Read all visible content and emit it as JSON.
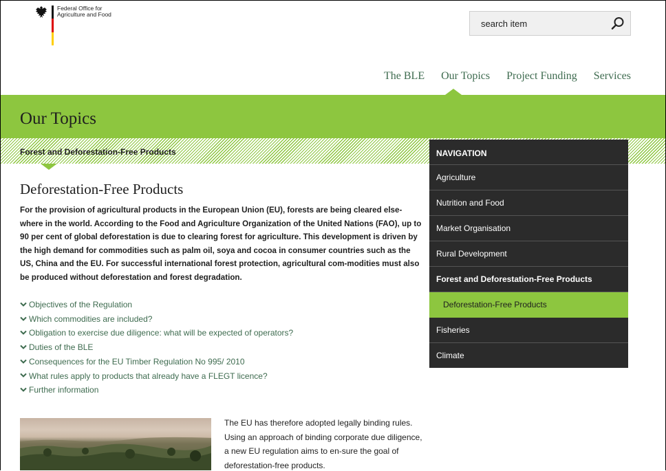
{
  "header": {
    "logo_line1": "Federal Office for",
    "logo_line2": "Agriculture and Food",
    "search_placeholder": "search item"
  },
  "topnav": [
    {
      "label": "The BLE"
    },
    {
      "label": "Our Topics"
    },
    {
      "label": "Project Funding"
    },
    {
      "label": "Services"
    }
  ],
  "banner": {
    "title": "Our Topics"
  },
  "breadcrumb": {
    "label": "Forest and Deforestation-Free Products"
  },
  "article": {
    "title": "Deforestation-Free Products",
    "intro": "For the provision of agricultural products in the European Union (EU), forests are being cleared else-where in the world. According to the Food and Agriculture Organization of the United Nations (FAO), up to 90 per cent of global deforestation is due to clearing forest for agriculture. This development is driven by the high demand for commodities such as palm oil, soya and cocoa in consumer countries such as the US, China and the EU. For successful international forest protection, agricultural com-modities must also be produced without deforestation and forest degradation.",
    "links": [
      "Objectives of the Regulation",
      "Which commodities are included?",
      "Obligation to exercise due diligence: what will be expected of operators?",
      "Duties of the BLE",
      "Consequences for the EU Timber Regulation No 995/ 2010",
      "What rules apply to products that already have a FLEGT licence?",
      "Further information"
    ],
    "body": "The EU has therefore adopted legally binding rules. Using an approach of binding corporate due diligence, a new EU regulation aims to en-sure the goal of deforestation-free products."
  },
  "sidenav": {
    "heading": "NAVIGATION",
    "items": [
      {
        "label": "Agriculture"
      },
      {
        "label": "Nutrition and Food"
      },
      {
        "label": "Market Organisation"
      },
      {
        "label": "Rural Development"
      },
      {
        "label": "Forest and Deforestation-Free Products"
      },
      {
        "label": "Deforestation-Free Products"
      },
      {
        "label": "Fisheries"
      },
      {
        "label": "Climate"
      }
    ]
  },
  "colors": {
    "accent_green": "#8dc63f",
    "link_green": "#3e6b4f",
    "nav_dark": "#2b2b2b"
  },
  "icons": {
    "search": "magnifier-icon",
    "link_bullet": "chevron-down-icon",
    "logo": "federal-eagle-icon"
  }
}
